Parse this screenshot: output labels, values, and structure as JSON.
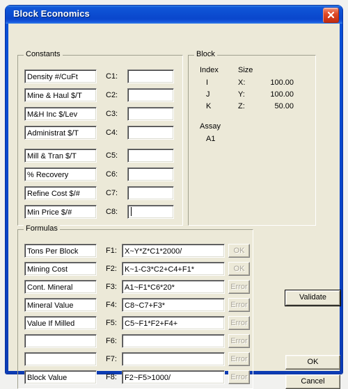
{
  "window": {
    "title": "Block Economics",
    "close_icon": "close-icon"
  },
  "constants": {
    "group_label": "Constants",
    "rows": [
      {
        "name": "Density  #/CuFt",
        "label": "C1:",
        "value": ""
      },
      {
        "name": "Mine & Haul $/T",
        "label": "C2:",
        "value": ""
      },
      {
        "name": "M&H Inc   $/Lev",
        "label": "C3:",
        "value": ""
      },
      {
        "name": "Administrat $/T",
        "label": "C4:",
        "value": ""
      },
      {
        "name": "Mill & Tran $/T",
        "label": "C5:",
        "value": ""
      },
      {
        "name": "% Recovery",
        "label": "C6:",
        "value": ""
      },
      {
        "name": "Refine Cost $/#",
        "label": "C7:",
        "value": ""
      },
      {
        "name": "Min Price   $/#",
        "label": "C8:",
        "value": ""
      }
    ]
  },
  "block": {
    "group_label": "Block",
    "index_header": "Index",
    "size_header": "Size",
    "indices": [
      "I",
      "J",
      "K"
    ],
    "axes": [
      "X:",
      "Y:",
      "Z:"
    ],
    "sizes": [
      "100.00",
      "100.00",
      "50.00"
    ],
    "assay_header": "Assay",
    "assay_value": "A1"
  },
  "formulas": {
    "group_label": "Formulas",
    "rows": [
      {
        "name": "Tons Per Block",
        "label": "F1:",
        "value": "X~Y*Z*C1*2000/",
        "status": "OK"
      },
      {
        "name": "Mining Cost",
        "label": "F2:",
        "value": "K~1-C3*C2+C4+F1*",
        "status": "OK"
      },
      {
        "name": "Cont. Mineral",
        "label": "F3:",
        "value": "A1~F1*C6*20*",
        "status": "Error"
      },
      {
        "name": "Mineral Value",
        "label": "F4:",
        "value": "C8~C7+F3*",
        "status": "Error"
      },
      {
        "name": "Value If Milled",
        "label": "F5:",
        "value": "C5~F1*F2+F4+",
        "status": "Error"
      },
      {
        "name": "",
        "label": "F6:",
        "value": "",
        "status": "Error"
      },
      {
        "name": "",
        "label": "F7:",
        "value": "",
        "status": "Error"
      },
      {
        "name": "Block Value",
        "label": "F8:",
        "value": "F2~F5>1000/",
        "status": "Error"
      }
    ]
  },
  "buttons": {
    "validate": "Validate",
    "ok": "OK",
    "cancel": "Cancel"
  },
  "colors": {
    "titlebar": "#0a44c8",
    "dialog_face": "#ece9d8",
    "close_button": "#c22c10",
    "field_background": "#ffffff",
    "disabled_text": "#aaa69a"
  }
}
